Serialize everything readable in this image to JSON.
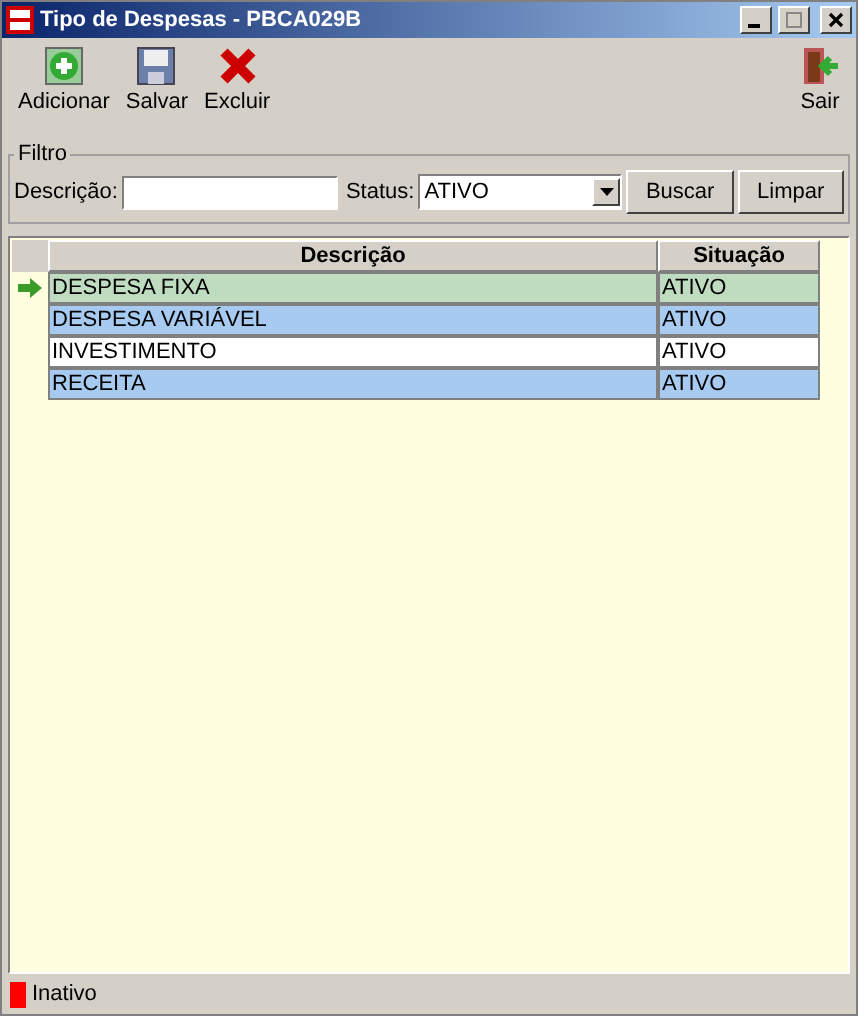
{
  "window": {
    "title": "Tipo de Despesas - PBCA029B"
  },
  "toolbar": [
    {
      "label": "Adicionar",
      "kind": "add"
    },
    {
      "label": "Salvar",
      "kind": "save"
    },
    {
      "label": "Excluir",
      "kind": "delete"
    },
    {
      "label": "Sair",
      "kind": "exit"
    }
  ],
  "filter": {
    "title": "Filtro",
    "description_label": "Descrição:",
    "status_label": "Status:",
    "status_value": "ATIVO",
    "buttons": [
      "Buscar",
      "Limpar"
    ]
  },
  "table": {
    "columns": [
      "Descrição",
      "Situação"
    ],
    "rows": [
      {
        "cells": [
          "DESPESA FIXA",
          "ATIVO"
        ],
        "selected": true
      },
      {
        "cells": [
          "DESPESA VARIÁVEL",
          "ATIVO"
        ],
        "selected": false,
        "color": "#a6caf0"
      },
      {
        "cells": [
          "INVESTIMENTO",
          "ATIVO"
        ],
        "selected": false,
        "color": "#ffffff"
      },
      {
        "cells": [
          "RECEITA",
          "ATIVO"
        ],
        "selected": false,
        "color": "#a6caf0"
      }
    ]
  },
  "status_bar": {
    "legend": [
      {
        "label": "Inativo",
        "color": "#ff0000"
      }
    ]
  }
}
